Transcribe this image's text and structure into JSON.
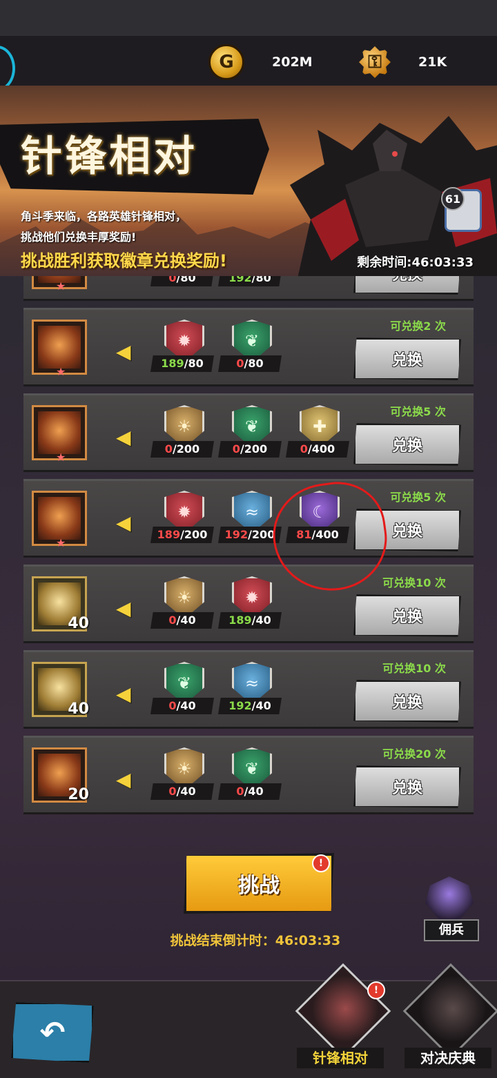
{
  "resources": {
    "gold": {
      "icon": "gold-coin-icon",
      "value": "202M"
    },
    "keys": {
      "icon": "key-medal-icon",
      "value": "21K"
    }
  },
  "banner": {
    "title": "针锋相对",
    "desc_line1": "角斗季来临，各路英雄针锋相对，",
    "desc_line2": "挑战他们兑换丰厚奖励!",
    "highlight": "挑战胜利获取徽章兑换奖励!",
    "remaining": "剩余时间:46:03:33",
    "chat_badge": "61"
  },
  "exchange": {
    "button_label": "兑换",
    "rows": [
      {
        "reward_icon": "mystery-box-icon",
        "reward_count": "",
        "limit": "",
        "requirements": [
          {
            "type": "red",
            "icon": "red-badge-icon",
            "have": "0",
            "need": "/80"
          },
          {
            "type": "green",
            "icon": "green-badge-icon",
            "have": "192",
            "need": "/80"
          }
        ]
      },
      {
        "reward_icon": "shadow-hero-icon",
        "reward_count": "",
        "limit": "可兑换2 次",
        "requirements": [
          {
            "type": "red",
            "icon": "red-badge-icon",
            "have": "189",
            "need": "/80"
          },
          {
            "type": "green",
            "icon": "green-badge-icon",
            "have": "0",
            "need": "/80"
          }
        ]
      },
      {
        "reward_icon": "treasure-chest-icon",
        "reward_count": "",
        "limit": "可兑换5 次",
        "requirements": [
          {
            "type": "sun",
            "icon": "sun-badge-icon",
            "have": "0",
            "need": "/200"
          },
          {
            "type": "green",
            "icon": "green-badge-icon",
            "have": "0",
            "need": "/200"
          },
          {
            "type": "cross",
            "icon": "cross-badge-icon",
            "have": "0",
            "need": "/400"
          }
        ]
      },
      {
        "reward_icon": "treasure-chest-icon",
        "reward_count": "",
        "limit": "可兑换5 次",
        "requirements": [
          {
            "type": "red",
            "icon": "red-badge-icon",
            "have": "189",
            "need": "/200"
          },
          {
            "type": "blue",
            "icon": "blue-badge-icon",
            "have": "192",
            "need": "/200"
          },
          {
            "type": "purple",
            "icon": "purple-badge-icon",
            "have": "81",
            "need": "/400"
          }
        ]
      },
      {
        "reward_icon": "potion-icon",
        "reward_count": "40",
        "limit": "可兑换10 次",
        "requirements": [
          {
            "type": "sun",
            "icon": "sun-badge-icon",
            "have": "0",
            "need": "/40"
          },
          {
            "type": "red",
            "icon": "red-badge-icon",
            "have": "189",
            "need": "/40"
          }
        ]
      },
      {
        "reward_icon": "potion-icon",
        "reward_count": "40",
        "limit": "可兑换10 次",
        "requirements": [
          {
            "type": "green",
            "icon": "green-badge-icon",
            "have": "0",
            "need": "/40"
          },
          {
            "type": "blue",
            "icon": "blue-badge-icon",
            "have": "192",
            "need": "/40"
          }
        ]
      },
      {
        "reward_icon": "relic-icon",
        "reward_count": "20",
        "limit": "可兑换20 次",
        "requirements": [
          {
            "type": "sun",
            "icon": "sun-badge-icon",
            "have": "0",
            "need": "/40"
          },
          {
            "type": "green",
            "icon": "green-badge-icon",
            "have": "0",
            "need": "/40"
          }
        ]
      }
    ]
  },
  "challenge": {
    "label": "挑战",
    "alert": "!"
  },
  "countdown": "挑战结束倒计时：46:03:33",
  "mercenary": {
    "label": "佣兵"
  },
  "tabs": [
    {
      "label": "针锋相对",
      "active": true,
      "alert": "!"
    },
    {
      "label": "对决庆典",
      "active": false
    }
  ],
  "back": {
    "icon": "back-arrow-icon"
  },
  "colors": {
    "accent_gold": "#f0c43a",
    "insufficient": "#ff4a4a",
    "sufficient": "#8bdb4a",
    "annotation_circle": "#e41a1a"
  }
}
